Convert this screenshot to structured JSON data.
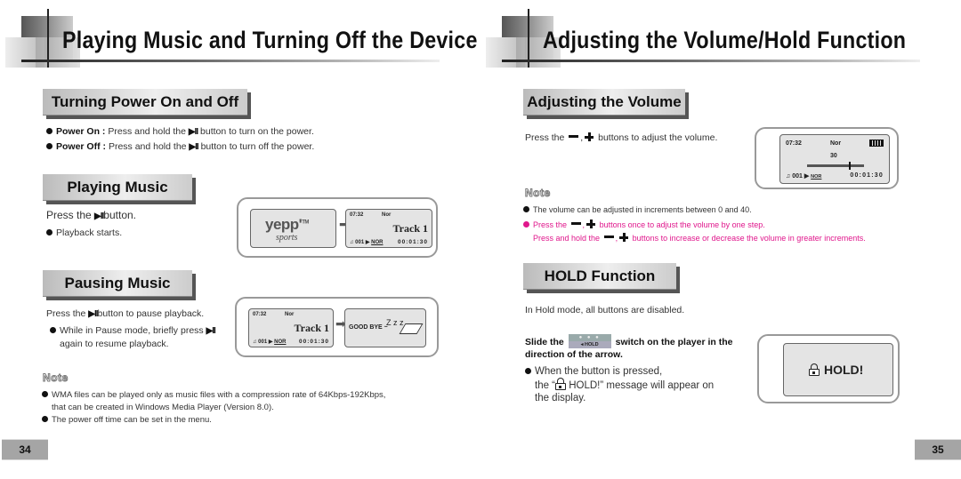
{
  "left_page": {
    "chapter_title": "Playing Music and Turning Off the Device",
    "page_number": "34",
    "sections": {
      "power": {
        "heading": "Turning Power On and Off",
        "items": [
          {
            "label": "Power On :",
            "text_before": "Press and hold the",
            "icon": "play-pause-icon",
            "text_after": "button to turn on the power."
          },
          {
            "label": "Power Off :",
            "text_before": "Press and hold the",
            "icon": "play-pause-icon",
            "text_after": "button to turn off the power."
          }
        ]
      },
      "playing": {
        "heading": "Playing Music",
        "instruction_before": "Press the",
        "instruction_after": "button.",
        "bullet": "Playback starts.",
        "screen1": {
          "brand": "yepp'",
          "tm": "TM",
          "subbrand": "sports"
        },
        "screen2": {
          "time": "07:32",
          "mode": "Nor",
          "track": "Track  1",
          "track_no": "001",
          "eq": "NOR",
          "elapsed": "00:01:30"
        }
      },
      "pausing": {
        "heading": "Pausing Music",
        "instruction_before": "Press the",
        "instruction_after": "button to pause playback.",
        "bullet_line1_before": "While in Pause mode, briefly press",
        "bullet_line2": "again to resume playback.",
        "screen1": {
          "time": "07:32",
          "mode": "Nor",
          "track": "Track  1",
          "track_no": "001",
          "eq": "NOR",
          "elapsed": "00:01:30"
        },
        "screen2": {
          "message": "GOOD BYE ~",
          "zzz": "Z z z"
        }
      },
      "note": {
        "heading": "Note",
        "items": [
          {
            "line1": "WMA files can be played only as music files with a compression rate of 64Kbps-192Kbps,",
            "line2": "that can be created in Windows Media Player (Version 8.0)."
          },
          {
            "line1": "The power off time can be set in the menu."
          }
        ]
      }
    }
  },
  "right_page": {
    "chapter_title": "Adjusting the Volume/Hold Function",
    "page_number": "35",
    "sections": {
      "volume": {
        "heading": "Adjusting the Volume",
        "instruction_before": "Press the",
        "instruction_after": "buttons  to adjust the volume.",
        "screen": {
          "time": "07:32",
          "mode": "Nor",
          "volume": "30",
          "volume_fraction": 0.75,
          "track_no": "001",
          "eq": "NOR",
          "elapsed": "00:01:30"
        }
      },
      "note": {
        "heading": "Note",
        "item1": "The volume can be adjusted in increments between 0 and 40.",
        "item2_before": "Press the",
        "item2_after": "buttons once to adjust the volume by one step.",
        "item3_before": "Press and hold the",
        "item3_after": "buttons to increase or decrease the volume in greater increments.",
        "accent_color": "#e0178c"
      },
      "hold": {
        "heading": "HOLD Function",
        "intro": "In Hold mode, all buttons are disabled.",
        "slide_before": "Slide the",
        "switch_dots": "● ● ●",
        "switch_label": "◂ HOLD",
        "slide_after": "switch on the player in the",
        "slide_line2": "direction of the arrow.",
        "bullet_line1": "When the button is pressed,",
        "bullet_line2_before": "the “",
        "bullet_line2_after": "HOLD!” message will appear on",
        "bullet_line3": "the display.",
        "screen_message": "HOLD!"
      }
    }
  }
}
